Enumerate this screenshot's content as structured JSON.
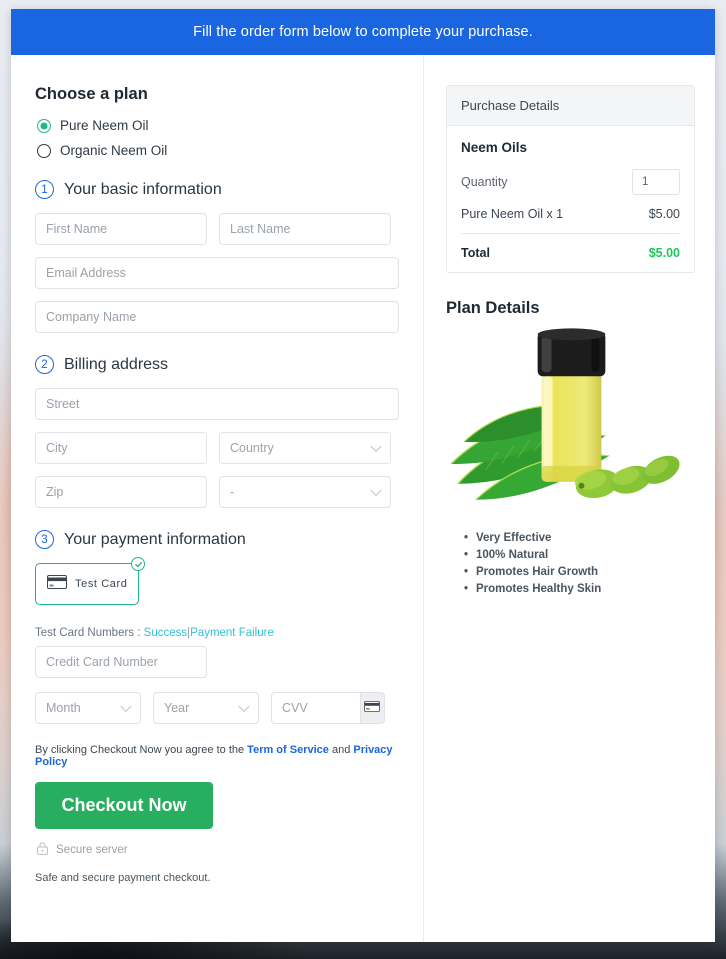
{
  "banner": {
    "text": "Fill the order form below to complete your purchase."
  },
  "plan": {
    "heading": "Choose a plan",
    "options": [
      {
        "label": "Pure Neem Oil",
        "selected": true
      },
      {
        "label": "Organic Neem Oil",
        "selected": false
      }
    ]
  },
  "steps": {
    "basic": {
      "num": "1",
      "title": "Your basic information"
    },
    "billing": {
      "num": "2",
      "title": "Billing address"
    },
    "payment": {
      "num": "3",
      "title": "Your payment information"
    }
  },
  "fields": {
    "first_name": "First Name",
    "last_name": "Last Name",
    "email": "Email Address",
    "company": "Company Name",
    "street": "Street",
    "city": "City",
    "country": "Country",
    "zip": "Zip",
    "state": "-",
    "credit_card": "Credit Card Number",
    "month": "Month",
    "year": "Year",
    "cvv": "CVV"
  },
  "payment": {
    "card_tile_label": "Test  Card",
    "card_icon": "credit-card-icon",
    "selected_icon": "check-circle-icon",
    "test_numbers_label": "Test Card Numbers :",
    "test_success": "Success",
    "test_separator": "|",
    "test_failure": "Payment Failure",
    "cvv_icon": "credit-card-icon"
  },
  "terms": {
    "prefix": "By clicking Checkout Now you agree to the",
    "tos": "Term of Service",
    "and": "and",
    "privacy": "Privacy Policy"
  },
  "checkout": {
    "button": "Checkout Now",
    "secure_icon": "lock-icon",
    "secure_label": "Secure server",
    "note": "Safe and secure payment checkout."
  },
  "purchase_details": {
    "header": "Purchase Details",
    "product": "Neem Oils",
    "quantity_label": "Quantity",
    "quantity_value": "1",
    "line_item": "Pure Neem Oil x 1",
    "line_price": "$5.00",
    "total_label": "Total",
    "total_price": "$5.00"
  },
  "plan_details": {
    "heading": "Plan Details",
    "image_alt": "neem-oil-bottle-image",
    "bullets": [
      "Very Effective",
      "100% Natural",
      "Promotes Hair Growth",
      "Promotes Healthy Skin"
    ]
  },
  "colors": {
    "banner_blue": "#1a66e0",
    "accent_green": "#1fb881",
    "checkout_green": "#27ae60",
    "total_green": "#22c55e",
    "link_teal": "#35bfd4",
    "link_blue": "#1a66e0"
  }
}
